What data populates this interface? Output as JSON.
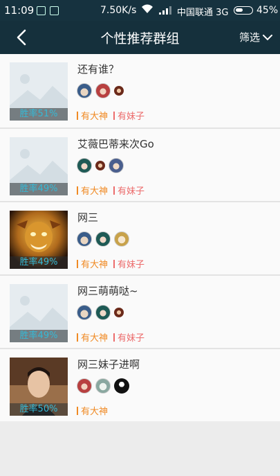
{
  "status_bar": {
    "time": "11:09",
    "speed": "7.50K/s",
    "carrier": "中国联通 3G",
    "battery": "45%"
  },
  "header": {
    "title": "个性推荐群组",
    "filter_label": "筛选"
  },
  "groups": [
    {
      "name": "还有谁？",
      "win_rate": "胜率51%",
      "thumb": "placeholder",
      "tags": [
        "有大神",
        "有妹子"
      ]
    },
    {
      "name": "艾薇巴蒂来次Go",
      "win_rate": "胜率49%",
      "thumb": "placeholder",
      "tags": [
        "有大神",
        "有妹子"
      ]
    },
    {
      "name": "网三",
      "win_rate": "胜率49%",
      "thumb": "golden-warrior",
      "tags": [
        "有大神",
        "有妹子"
      ]
    },
    {
      "name": "网三萌萌哒~",
      "win_rate": "胜率49%",
      "thumb": "placeholder",
      "tags": [
        "有大神",
        "有妹子"
      ]
    },
    {
      "name": "网三妹子进啊",
      "win_rate": "胜率50%",
      "thumb": "man-photo",
      "tags": [
        "有大神"
      ]
    }
  ],
  "colors": {
    "header_bg": "#15303c",
    "win_rate_text": "#35b9d6",
    "tag_god": "#f08a24",
    "tag_girl": "#ec6b6b"
  }
}
